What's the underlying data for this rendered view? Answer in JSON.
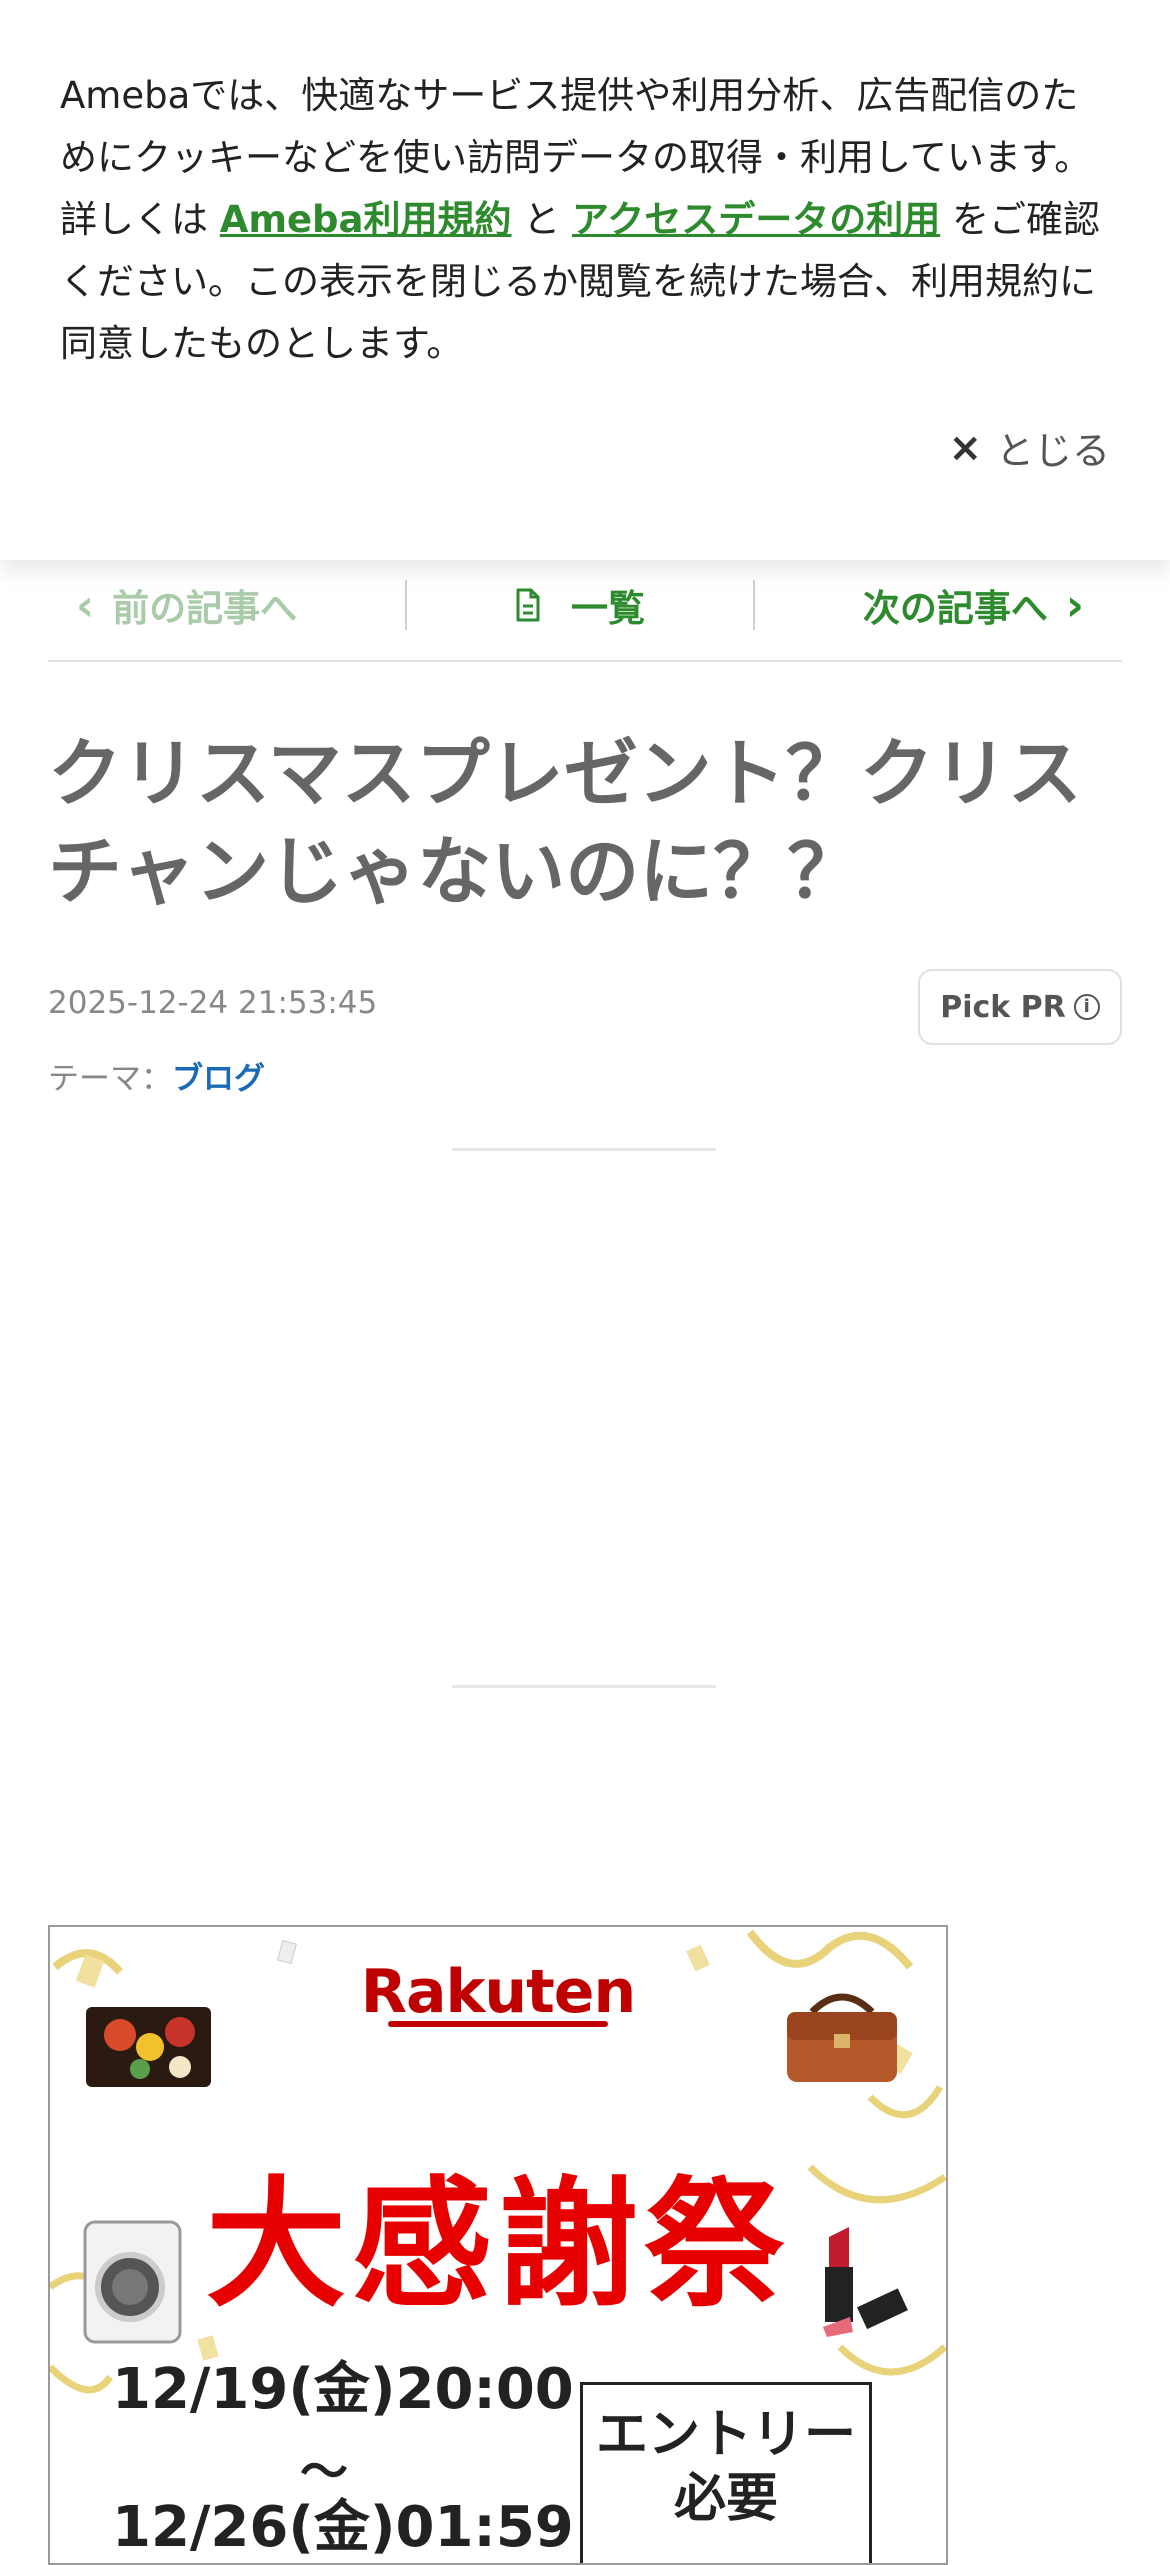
{
  "cookie": {
    "text_parts": [
      "Amebaでは、快適なサービス提供や利用分析、広告配信のためにクッキーなどを使い訪問データの取得・利用しています。詳しくは ",
      "Ameba利用規約",
      " と ",
      "アクセスデータの利用",
      " をご確認ください。この表示を閉じるか閲覧を続けた場合、利用規約に同意したものとします。"
    ],
    "close_label": "とじる",
    "close_icon": "×"
  },
  "nav": {
    "prev_label": "前の記事へ",
    "list_label": "一覧",
    "next_label": "次の記事へ"
  },
  "article": {
    "title": "クリスマスプレゼント？クリスチャンじゃないのに？？",
    "datetime": "2025-12-24 21:53:45",
    "theme_label": "テーマ：",
    "theme_value": "ブログ",
    "pickpr_label": "Pick PR",
    "pickpr_info_icon": "i"
  },
  "banner": {
    "brand": "Rakuten",
    "headline": "大感謝祭",
    "start": "12/19(金)20:00",
    "tilde": "～",
    "end": "12/26(金)01:59",
    "entry_line1": "エントリー",
    "entry_line2": "必要"
  },
  "colors": {
    "accent_green": "#2d8a2d",
    "link_blue": "#1a6bb5",
    "rakuten_red": "#bf0000"
  }
}
